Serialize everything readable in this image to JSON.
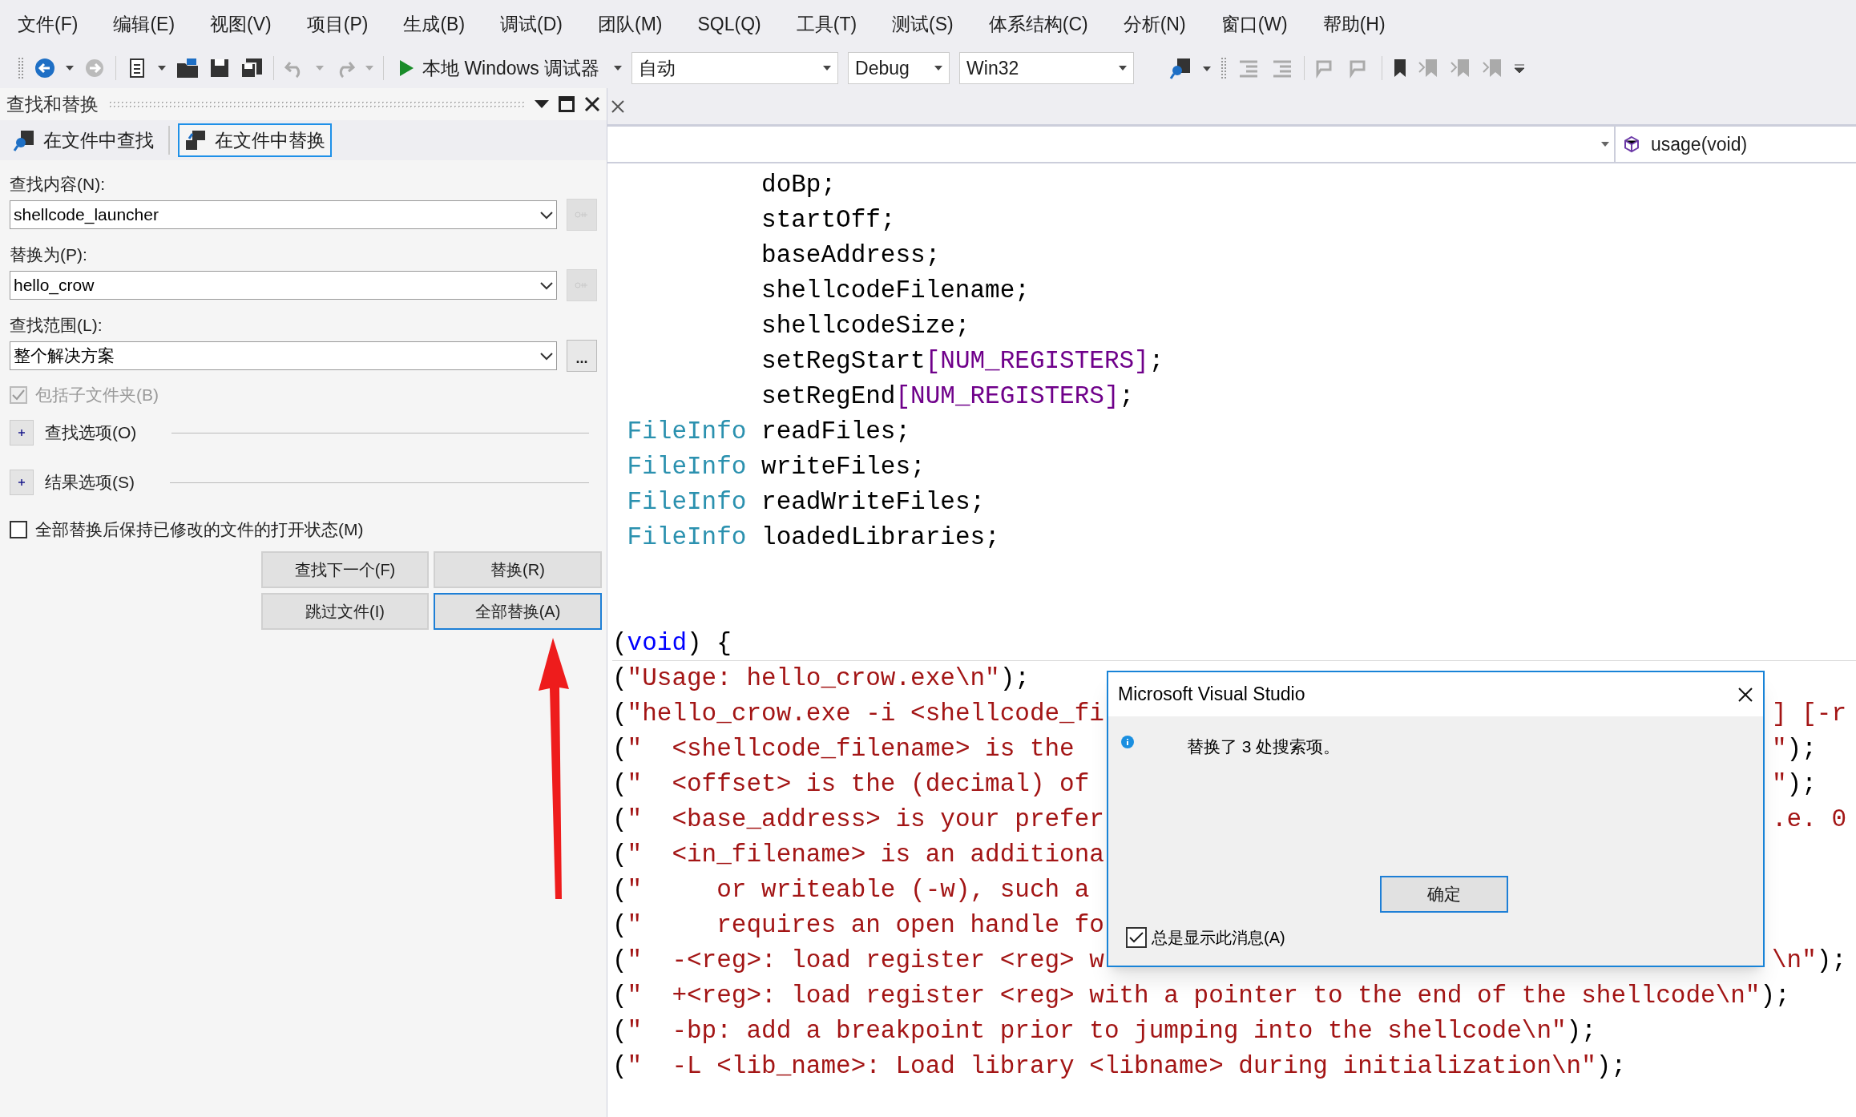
{
  "menu": [
    {
      "label": "文件(F)"
    },
    {
      "label": "编辑(E)"
    },
    {
      "label": "视图(V)"
    },
    {
      "label": "项目(P)"
    },
    {
      "label": "生成(B)"
    },
    {
      "label": "调试(D)"
    },
    {
      "label": "团队(M)"
    },
    {
      "label": "SQL(Q)"
    },
    {
      "label": "工具(T)"
    },
    {
      "label": "测试(S)"
    },
    {
      "label": "体系结构(C)"
    },
    {
      "label": "分析(N)"
    },
    {
      "label": "窗口(W)"
    },
    {
      "label": "帮助(H)"
    }
  ],
  "toolbar": {
    "debugger": "本地 Windows 调试器",
    "combos": [
      {
        "value": "自动"
      },
      {
        "value": "Debug"
      },
      {
        "value": "Win32"
      }
    ]
  },
  "find_panel": {
    "title": "查找和替换",
    "tabs": [
      {
        "label": "在文件中查找",
        "selected": false
      },
      {
        "label": "在文件中替换",
        "selected": true
      }
    ],
    "fields": [
      {
        "label": "查找内容(N):",
        "value": "shellcode_launcher",
        "side": {
          "kind": "regex",
          "disabled": true
        }
      },
      {
        "label": "替换为(P):",
        "value": "hello_crow",
        "side": {
          "kind": "regex",
          "disabled": true
        }
      },
      {
        "label": "查找范围(L):",
        "value": "整个解决方案",
        "side": {
          "kind": "browse",
          "text": "..."
        }
      }
    ],
    "subfolders": {
      "label": "包括子文件夹(B)",
      "checked": true,
      "disabled": true
    },
    "sections": [
      {
        "label": "查找选项(O)",
        "expanded": false
      },
      {
        "label": "结果选项(S)",
        "expanded": false
      }
    ],
    "keep_open": {
      "label": "全部替换后保持已修改的文件的打开状态(M)",
      "checked": false
    },
    "buttons": [
      {
        "label": "查找下一个(F)",
        "focused": false
      },
      {
        "label": "替换(R)",
        "focused": false
      },
      {
        "label": "跳过文件(I)",
        "focused": false
      },
      {
        "label": "全部替换(A)",
        "focused": true
      }
    ]
  },
  "editor": {
    "member": "usage(void)",
    "lines": [
      {
        "kind": "code",
        "segments": [
          {
            "kind": "plain",
            "text": "          doBp;"
          }
        ]
      },
      {
        "kind": "code",
        "segments": [
          {
            "kind": "plain",
            "text": "          startOff;"
          }
        ]
      },
      {
        "kind": "code",
        "segments": [
          {
            "kind": "plain",
            "text": "          baseAddress;"
          }
        ]
      },
      {
        "kind": "code",
        "segments": [
          {
            "kind": "plain",
            "text": "          shellcodeFilename;"
          }
        ]
      },
      {
        "kind": "code",
        "segments": [
          {
            "kind": "plain",
            "text": "          shellcodeSize;"
          }
        ]
      },
      {
        "kind": "code",
        "segments": [
          {
            "kind": "plain",
            "text": "          setRegStart"
          },
          {
            "kind": "macro",
            "text": "[NUM_REGISTERS]"
          },
          {
            "kind": "plain",
            "text": ";"
          }
        ]
      },
      {
        "kind": "code",
        "segments": [
          {
            "kind": "plain",
            "text": "          setRegEnd"
          },
          {
            "kind": "macro",
            "text": "[NUM_REGISTERS]"
          },
          {
            "kind": "plain",
            "text": ";"
          }
        ]
      },
      {
        "kind": "code",
        "segments": [
          {
            "kind": "type",
            "text": " FileInfo"
          },
          {
            "kind": "plain",
            "text": " readFiles;"
          }
        ]
      },
      {
        "kind": "code",
        "segments": [
          {
            "kind": "type",
            "text": " FileInfo"
          },
          {
            "kind": "plain",
            "text": " writeFiles;"
          }
        ]
      },
      {
        "kind": "code",
        "segments": [
          {
            "kind": "type",
            "text": " FileInfo"
          },
          {
            "kind": "plain",
            "text": " readWriteFiles;"
          }
        ]
      },
      {
        "kind": "code",
        "segments": [
          {
            "kind": "type",
            "text": " FileInfo"
          },
          {
            "kind": "plain",
            "text": " loadedLibraries;"
          }
        ]
      },
      {
        "kind": "blank"
      },
      {
        "kind": "blank"
      },
      {
        "kind": "code",
        "separator": true,
        "segments": [
          {
            "kind": "plain",
            "text": "("
          },
          {
            "kind": "keyword",
            "text": "void"
          },
          {
            "kind": "plain",
            "text": ") {"
          }
        ]
      },
      {
        "kind": "code",
        "segments": [
          {
            "kind": "plain",
            "text": "("
          },
          {
            "kind": "string",
            "text": "\"Usage: hello_crow.exe\\n\""
          },
          {
            "kind": "plain",
            "text": ");"
          }
        ]
      },
      {
        "kind": "code",
        "segments": [
          {
            "kind": "plain",
            "text": "("
          },
          {
            "kind": "string",
            "text": "\"hello_crow.exe -i <shellcode_fi"
          }
        ],
        "right": [
          {
            "kind": "string",
            "text": "] [-r"
          }
        ]
      },
      {
        "kind": "code",
        "segments": [
          {
            "kind": "plain",
            "text": "("
          },
          {
            "kind": "string",
            "text": "\"  <shellcode_filename> is the"
          }
        ],
        "right": [
          {
            "kind": "string",
            "text": "\""
          },
          {
            "kind": "plain",
            "text": ");"
          }
        ]
      },
      {
        "kind": "code",
        "segments": [
          {
            "kind": "plain",
            "text": "("
          },
          {
            "kind": "string",
            "text": "\"  <offset> is the (decimal) of"
          }
        ],
        "right": [
          {
            "kind": "string",
            "text": "\""
          },
          {
            "kind": "plain",
            "text": ");"
          }
        ]
      },
      {
        "kind": "code",
        "segments": [
          {
            "kind": "plain",
            "text": "("
          },
          {
            "kind": "string",
            "text": "\"  <base_address> is your prefer"
          }
        ],
        "right": [
          {
            "kind": "string",
            "text": ".e. 0"
          }
        ]
      },
      {
        "kind": "code",
        "segments": [
          {
            "kind": "plain",
            "text": "("
          },
          {
            "kind": "string",
            "text": "\"  <in_filename> is an additiona"
          }
        ]
      },
      {
        "kind": "code",
        "segments": [
          {
            "kind": "plain",
            "text": "("
          },
          {
            "kind": "string",
            "text": "\"     or writeable (-w), such a"
          }
        ]
      },
      {
        "kind": "code",
        "segments": [
          {
            "kind": "plain",
            "text": "("
          },
          {
            "kind": "string",
            "text": "\"     requires an open handle fo"
          }
        ]
      },
      {
        "kind": "code",
        "segments": [
          {
            "kind": "plain",
            "text": "("
          },
          {
            "kind": "string",
            "text": "\"  -<reg>: load register <reg> w"
          }
        ],
        "right": [
          {
            "kind": "string",
            "text": "\\n\""
          },
          {
            "kind": "plain",
            "text": ");"
          }
        ]
      },
      {
        "kind": "code",
        "segments": [
          {
            "kind": "plain",
            "text": "("
          },
          {
            "kind": "string",
            "text": "\"  +<reg>: load register <reg> with a pointer to the end of the shellcode\\n\""
          },
          {
            "kind": "plain",
            "text": ");"
          }
        ]
      },
      {
        "kind": "code",
        "segments": [
          {
            "kind": "plain",
            "text": "("
          },
          {
            "kind": "string",
            "text": "\"  -bp: add a breakpoint prior to jumping into the shellcode\\n\""
          },
          {
            "kind": "plain",
            "text": ");"
          }
        ]
      },
      {
        "kind": "code",
        "segments": [
          {
            "kind": "plain",
            "text": "("
          },
          {
            "kind": "string",
            "text": "\"  -L <lib_name>: Load library <libname> during initialization\\n\""
          },
          {
            "kind": "plain",
            "text": ");"
          }
        ]
      }
    ]
  },
  "dialog": {
    "title": "Microsoft Visual Studio",
    "message": "替换了 3 处搜索项。",
    "button": "确定",
    "checkbox": {
      "label": "总是显示此消息(A)",
      "checked": true
    }
  }
}
